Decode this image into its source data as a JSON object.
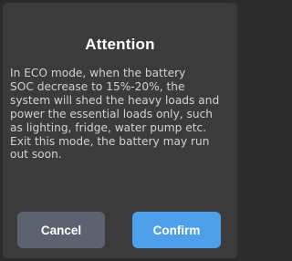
{
  "dialog": {
    "title": "Attention",
    "message": "In ECO mode, when the battery\nSOC decrease to 15%-20%, the\nsystem will shed the heavy loads and\npower the essential loads only, such\nas lighting, fridge, water pump etc.\nExit this mode, the battery may run\nout soon.",
    "buttons": {
      "cancel_label": "Cancel",
      "confirm_label": "Confirm"
    }
  },
  "colors": {
    "background": "#2c2c2c",
    "dialog_bg": "#3b3b3b",
    "cancel_bg": "#5d6270",
    "confirm_bg": "#4d9fe9",
    "title_text": "#ffffff",
    "message_text": "#d2d2d2"
  }
}
